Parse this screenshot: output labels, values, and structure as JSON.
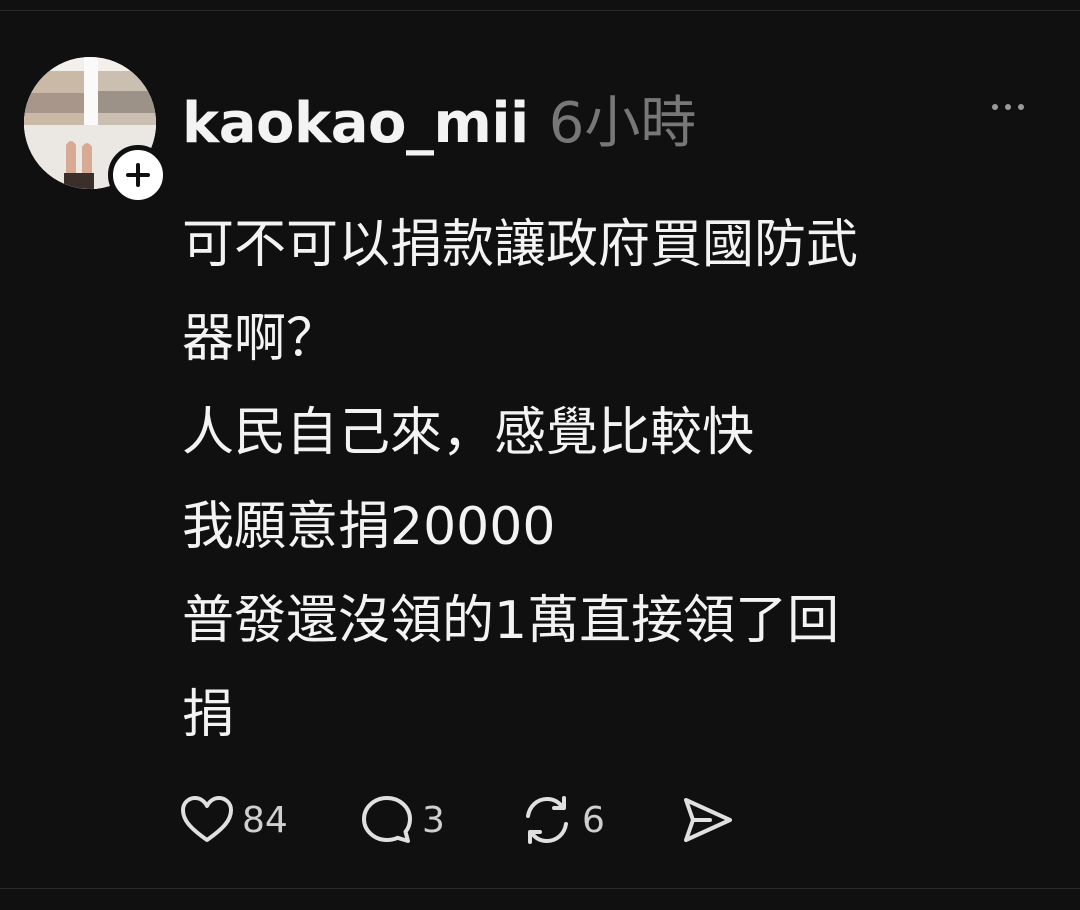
{
  "post": {
    "username": "kaokao_mii",
    "timestamp": "6小時",
    "lines": [
      "可不可以捐款讓政府買國防武",
      "器啊？",
      "人民自己來，感覺比較快",
      "我願意捐20000",
      "普發還沒領的1萬直接領了回",
      "捐"
    ]
  },
  "actions": {
    "likes": "84",
    "replies": "3",
    "reposts": "6"
  },
  "icons": {
    "like": "heart-icon",
    "reply": "speech-bubble-icon",
    "repost": "repost-icon",
    "share": "send-icon",
    "more": "more-dots-icon",
    "follow": "plus-icon"
  },
  "colors": {
    "background": "#101010",
    "text": "#f3f3f3",
    "muted": "#777777"
  }
}
